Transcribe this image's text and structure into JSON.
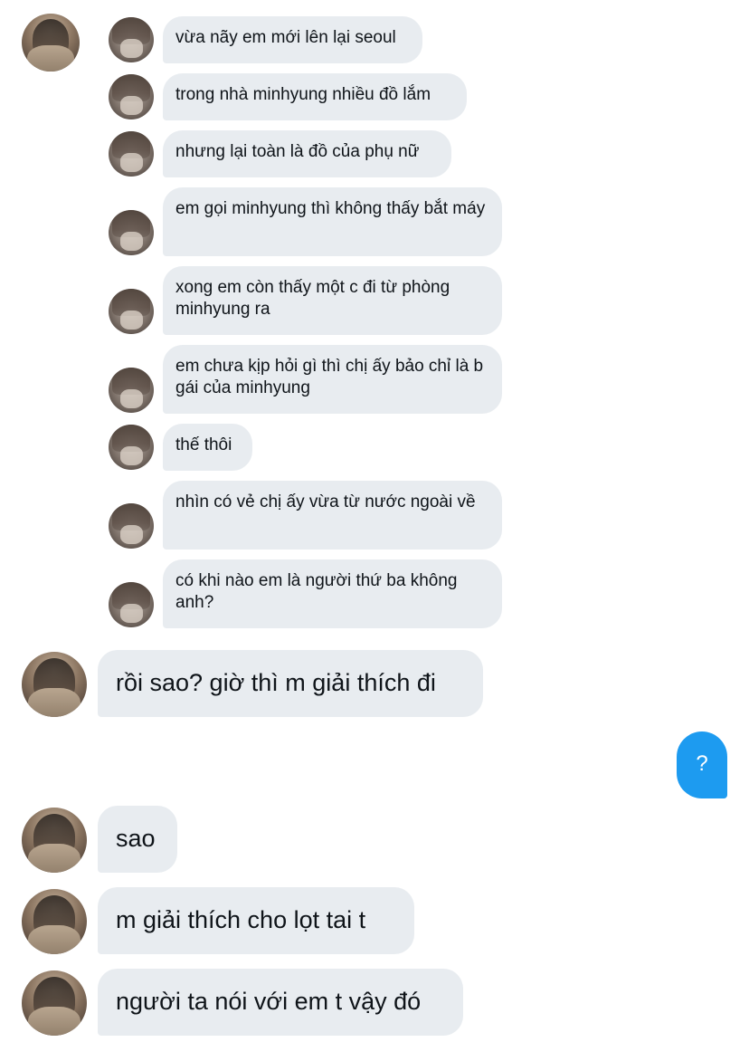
{
  "conversation": {
    "quoted": [
      {
        "text": "vừa nãy em mới lên lại seoul"
      },
      {
        "text": "trong nhà minhyung nhiều đồ lắm"
      },
      {
        "text": "nhưng lại toàn là đồ của phụ nữ"
      },
      {
        "text": "em gọi minhyung thì không thấy bắt máy"
      },
      {
        "text": "xong em còn thấy một c đi từ phòng minhyung ra"
      },
      {
        "text": "em chưa kịp hỏi gì thì chị ấy bảo chỉ là b gái của minhyung"
      },
      {
        "text": "thế thôi"
      },
      {
        "text": "nhìn có vẻ chị ấy vừa từ nước ngoài về"
      },
      {
        "text": "có khi nào em là người thứ ba không anh?"
      }
    ],
    "messages": [
      {
        "text": "rồi sao? giờ thì m giải thích đi"
      },
      {
        "text": "?"
      },
      {
        "text": "sao"
      },
      {
        "text": "m giải thích cho lọt tai t"
      },
      {
        "text": "người ta nói với em t vậy đó"
      }
    ]
  }
}
